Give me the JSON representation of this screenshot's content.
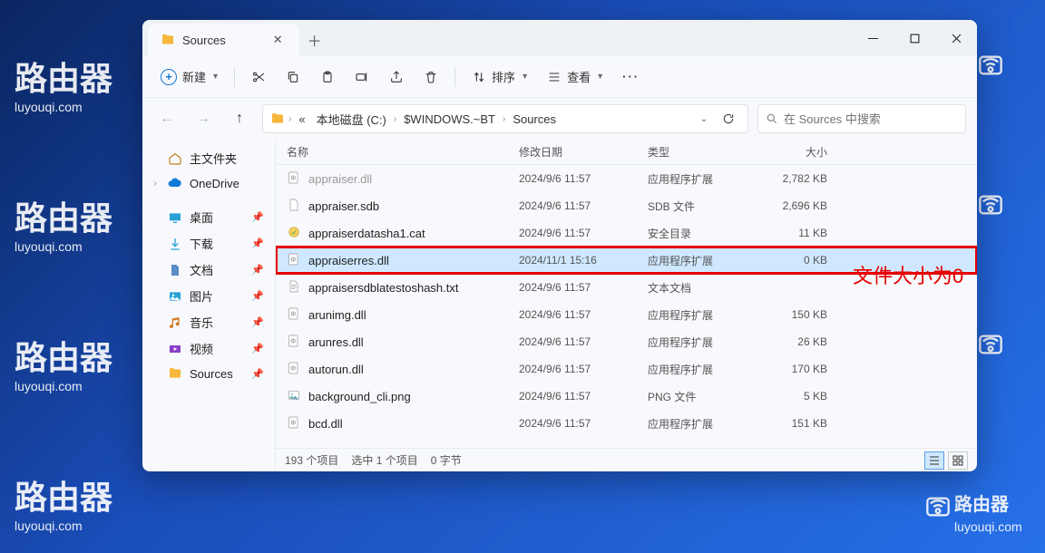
{
  "watermark": {
    "big": "路由器",
    "small": "luyouqi.com"
  },
  "window": {
    "tab_title": "Sources",
    "toolbar": {
      "new": "新建",
      "sort": "排序",
      "view": "查看"
    },
    "breadcrumb": {
      "root_prefix": "«",
      "root": "本地磁盘 (C:)",
      "seg1": "$WINDOWS.~BT",
      "seg2": "Sources"
    },
    "search_placeholder": "在 Sources 中搜索",
    "nav": {
      "home": "主文件夹",
      "onedrive": "OneDrive",
      "desktop": "桌面",
      "downloads": "下载",
      "documents": "文档",
      "pictures": "图片",
      "music": "音乐",
      "videos": "视频",
      "sources": "Sources"
    },
    "columns": {
      "name": "名称",
      "date": "修改日期",
      "type": "类型",
      "size": "大小"
    },
    "files": [
      {
        "name": "appraiser.dll",
        "date": "2024/9/6 11:57",
        "type": "应用程序扩展",
        "size": "2,782 KB",
        "icon": "dll",
        "dim": true
      },
      {
        "name": "appraiser.sdb",
        "date": "2024/9/6 11:57",
        "type": "SDB 文件",
        "size": "2,696 KB",
        "icon": "file"
      },
      {
        "name": "appraiserdatasha1.cat",
        "date": "2024/9/6 11:57",
        "type": "安全目录",
        "size": "11 KB",
        "icon": "cat"
      },
      {
        "name": "appraiserres.dll",
        "date": "2024/11/1 15:16",
        "type": "应用程序扩展",
        "size": "0 KB",
        "icon": "dll",
        "hl": true
      },
      {
        "name": "appraisersdblatestoshash.txt",
        "date": "2024/9/6 11:57",
        "type": "文本文档",
        "size": "",
        "icon": "txt"
      },
      {
        "name": "arunimg.dll",
        "date": "2024/9/6 11:57",
        "type": "应用程序扩展",
        "size": "150 KB",
        "icon": "dll"
      },
      {
        "name": "arunres.dll",
        "date": "2024/9/6 11:57",
        "type": "应用程序扩展",
        "size": "26 KB",
        "icon": "dll"
      },
      {
        "name": "autorun.dll",
        "date": "2024/9/6 11:57",
        "type": "应用程序扩展",
        "size": "170 KB",
        "icon": "dll"
      },
      {
        "name": "background_cli.png",
        "date": "2024/9/6 11:57",
        "type": "PNG 文件",
        "size": "5 KB",
        "icon": "png"
      },
      {
        "name": "bcd.dll",
        "date": "2024/9/6 11:57",
        "type": "应用程序扩展",
        "size": "151 KB",
        "icon": "dll"
      }
    ],
    "status": {
      "count": "193 个项目",
      "selected": "选中 1 个项目",
      "bytes": "0 字节"
    }
  },
  "annotation": "文件大小为0"
}
